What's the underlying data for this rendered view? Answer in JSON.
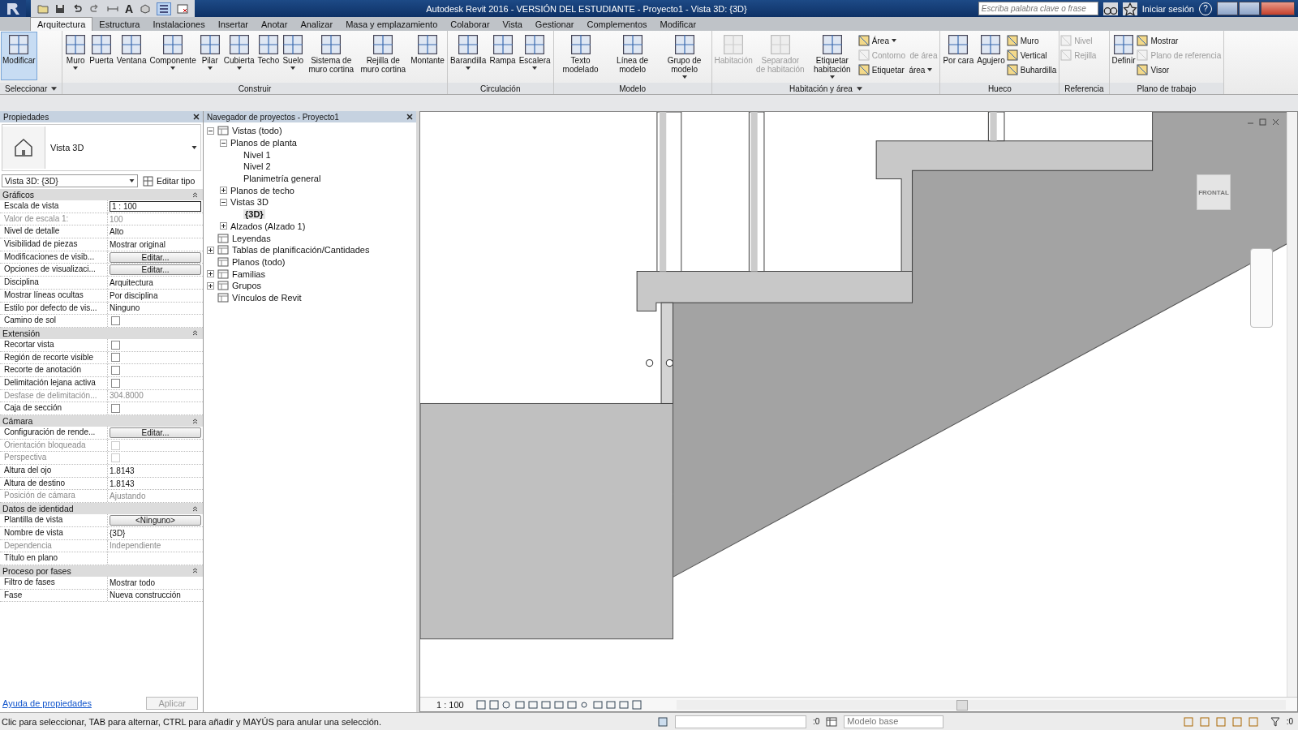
{
  "title_bar": {
    "title": "Autodesk Revit 2016 - VERSIÓN DEL ESTUDIANTE - Proyecto1 - Vista 3D: {3D}",
    "text_tool": "A",
    "search": {
      "placeholder": "Escriba palabra clave o frase"
    },
    "sign_in": "Iniciar sesión",
    "help": "?"
  },
  "tabs": [
    {
      "label": "Arquitectura",
      "selected": true
    },
    {
      "label": "Estructura",
      "selected": false
    },
    {
      "label": "Instalaciones",
      "selected": false
    },
    {
      "label": "Insertar",
      "selected": false
    },
    {
      "label": "Anotar",
      "selected": false
    },
    {
      "label": "Analizar",
      "selected": false
    },
    {
      "label": "Masa y emplazamiento",
      "selected": false
    },
    {
      "label": "Colaborar",
      "selected": false
    },
    {
      "label": "Vista",
      "selected": false
    },
    {
      "label": "Gestionar",
      "selected": false
    },
    {
      "label": "Complementos",
      "selected": false
    },
    {
      "label": "Modificar",
      "selected": false
    }
  ],
  "ribbon": [
    {
      "title": "Seleccionar",
      "menu": true,
      "tools": [
        {
          "label": "Modificar",
          "kind": "large",
          "selected": true,
          "disabled": false,
          "dropdown": false
        }
      ]
    },
    {
      "title": "Construir",
      "menu": false,
      "tools": [
        {
          "label": "Muro",
          "kind": "large",
          "selected": false,
          "disabled": false,
          "dropdown": true
        },
        {
          "label": "Puerta",
          "kind": "large",
          "selected": false,
          "disabled": false,
          "dropdown": false
        },
        {
          "label": "Ventana",
          "kind": "large",
          "selected": false,
          "disabled": false,
          "dropdown": false
        },
        {
          "label": "Componente",
          "kind": "large",
          "selected": false,
          "disabled": false,
          "dropdown": true
        },
        {
          "label": "Pilar",
          "kind": "large",
          "selected": false,
          "disabled": false,
          "dropdown": true
        },
        {
          "label": "Cubierta",
          "kind": "large",
          "selected": false,
          "disabled": false,
          "dropdown": true
        },
        {
          "label": "Techo",
          "kind": "large",
          "selected": false,
          "disabled": false,
          "dropdown": false
        },
        {
          "label": "Suelo",
          "kind": "large",
          "selected": false,
          "disabled": false,
          "dropdown": true
        },
        {
          "label": "Sistema de muro cortina",
          "kind": "large",
          "selected": false,
          "disabled": false,
          "dropdown": false
        },
        {
          "label": "Rejilla de muro cortina",
          "kind": "large",
          "selected": false,
          "disabled": false,
          "dropdown": false
        },
        {
          "label": "Montante",
          "kind": "large",
          "selected": false,
          "disabled": false,
          "dropdown": false
        }
      ]
    },
    {
      "title": "Circulación",
      "menu": false,
      "tools": [
        {
          "label": "Barandilla",
          "kind": "large",
          "selected": false,
          "disabled": false,
          "dropdown": true
        },
        {
          "label": "Rampa",
          "kind": "large",
          "selected": false,
          "disabled": false,
          "dropdown": false
        },
        {
          "label": "Escalera",
          "kind": "large",
          "selected": false,
          "disabled": false,
          "dropdown": true
        }
      ]
    },
    {
      "title": "Modelo",
      "menu": false,
      "tools": [
        {
          "label": "Texto modelado",
          "kind": "large",
          "selected": false,
          "disabled": false,
          "dropdown": false
        },
        {
          "label": "Línea de modelo",
          "kind": "large",
          "selected": false,
          "disabled": false,
          "dropdown": false
        },
        {
          "label": "Grupo de modelo",
          "kind": "large",
          "selected": false,
          "disabled": false,
          "dropdown": true
        }
      ]
    },
    {
      "title": "Habitación y área",
      "menu": true,
      "tools": [
        {
          "label": "Habitación",
          "kind": "large",
          "selected": false,
          "disabled": true,
          "dropdown": false
        },
        {
          "label": "Separador de habitación",
          "kind": "large",
          "selected": false,
          "disabled": true,
          "dropdown": false
        },
        {
          "label": "Etiquetar habitación",
          "kind": "large",
          "selected": false,
          "disabled": false,
          "dropdown": true
        },
        {
          "label": "Área",
          "kind": "small",
          "selected": false,
          "disabled": false,
          "dropdown": true
        },
        {
          "label": "Contorno  de área",
          "kind": "small",
          "selected": false,
          "disabled": true,
          "dropdown": false
        },
        {
          "label": "Etiquetar  área",
          "kind": "small",
          "selected": false,
          "disabled": false,
          "dropdown": true
        }
      ]
    },
    {
      "title": "Hueco",
      "menu": false,
      "tools": [
        {
          "label": "Por cara",
          "kind": "large",
          "selected": false,
          "disabled": false,
          "dropdown": false
        },
        {
          "label": "Agujero",
          "kind": "large",
          "selected": false,
          "disabled": false,
          "dropdown": false
        },
        {
          "label": "Muro",
          "kind": "small",
          "selected": false,
          "disabled": false,
          "dropdown": false
        },
        {
          "label": "Vertical",
          "kind": "small",
          "selected": false,
          "disabled": false,
          "dropdown": false
        },
        {
          "label": "Buhardilla",
          "kind": "small",
          "selected": false,
          "disabled": false,
          "dropdown": false
        }
      ]
    },
    {
      "title": "Referencia",
      "menu": false,
      "tools": [
        {
          "label": "Nivel",
          "kind": "small",
          "selected": false,
          "disabled": true,
          "dropdown": false
        },
        {
          "label": "Rejilla",
          "kind": "small",
          "selected": false,
          "disabled": true,
          "dropdown": false
        }
      ]
    },
    {
      "title": "Plano de trabajo",
      "menu": false,
      "tools": [
        {
          "label": "Definir",
          "kind": "large",
          "selected": false,
          "disabled": false,
          "dropdown": false
        },
        {
          "label": "Mostrar",
          "kind": "small",
          "selected": false,
          "disabled": false,
          "dropdown": false
        },
        {
          "label": "Plano de referencia",
          "kind": "small",
          "selected": false,
          "disabled": true,
          "dropdown": false
        },
        {
          "label": "Visor",
          "kind": "small",
          "selected": false,
          "disabled": false,
          "dropdown": false
        }
      ]
    }
  ],
  "properties": {
    "title": "Propiedades",
    "type_name": "Vista 3D",
    "type_selector": "Vista 3D: {3D}",
    "edit_type": "Editar tipo",
    "groups": [
      {
        "name": "Gráficos",
        "rows": [
          {
            "label": "Escala de vista",
            "kind": "input",
            "value": "1 : 100",
            "disabled": false
          },
          {
            "label": "Valor de escala    1:",
            "kind": "text",
            "value": "100",
            "disabled": true
          },
          {
            "label": "Nivel de detalle",
            "kind": "text",
            "value": "Alto",
            "disabled": false
          },
          {
            "label": "Visibilidad de piezas",
            "kind": "text",
            "value": "Mostrar original",
            "disabled": false
          },
          {
            "label": "Modificaciones de visib...",
            "kind": "button",
            "value": "Editar...",
            "disabled": false
          },
          {
            "label": "Opciones de visualizaci...",
            "kind": "button",
            "value": "Editar...",
            "disabled": false
          },
          {
            "label": "Disciplina",
            "kind": "text",
            "value": "Arquitectura",
            "disabled": false
          },
          {
            "label": "Mostrar líneas ocultas",
            "kind": "text",
            "value": "Por disciplina",
            "disabled": false
          },
          {
            "label": "Estilo por defecto de vis...",
            "kind": "text",
            "value": "Ninguno",
            "disabled": false
          },
          {
            "label": "Camino de sol",
            "kind": "checkbox",
            "checked": false,
            "disabled": false
          }
        ]
      },
      {
        "name": "Extensión",
        "rows": [
          {
            "label": "Recortar vista",
            "kind": "checkbox",
            "checked": false,
            "disabled": false
          },
          {
            "label": "Región de recorte visible",
            "kind": "checkbox",
            "checked": false,
            "disabled": false
          },
          {
            "label": "Recorte de anotación",
            "kind": "checkbox",
            "checked": false,
            "disabled": false
          },
          {
            "label": "Delimitación lejana activa",
            "kind": "checkbox",
            "checked": false,
            "disabled": false
          },
          {
            "label": "Desfase de delimitación...",
            "kind": "text",
            "value": "304.8000",
            "disabled": true
          },
          {
            "label": "Caja de sección",
            "kind": "checkbox",
            "checked": false,
            "disabled": false
          }
        ]
      },
      {
        "name": "Cámara",
        "rows": [
          {
            "label": "Configuración de rende...",
            "kind": "button",
            "value": "Editar...",
            "disabled": false
          },
          {
            "label": "Orientación bloqueada",
            "kind": "checkbox",
            "checked": false,
            "disabled": true
          },
          {
            "label": "Perspectiva",
            "kind": "checkbox",
            "checked": false,
            "disabled": true
          },
          {
            "label": "Altura del ojo",
            "kind": "text",
            "value": "1.8143",
            "disabled": false
          },
          {
            "label": "Altura de destino",
            "kind": "text",
            "value": "1.8143",
            "disabled": false
          },
          {
            "label": "Posición de cámara",
            "kind": "text",
            "value": "Ajustando",
            "disabled": true
          }
        ]
      },
      {
        "name": "Datos de identidad",
        "rows": [
          {
            "label": "Plantilla de vista",
            "kind": "button",
            "value": "<Ninguno>",
            "disabled": false
          },
          {
            "label": "Nombre de vista",
            "kind": "text",
            "value": "{3D}",
            "disabled": false
          },
          {
            "label": "Dependencia",
            "kind": "text",
            "value": "Independiente",
            "disabled": true
          },
          {
            "label": "Título en plano",
            "kind": "text",
            "value": "",
            "disabled": false
          }
        ]
      },
      {
        "name": "Proceso por fases",
        "rows": [
          {
            "label": "Filtro de fases",
            "kind": "text",
            "value": "Mostrar todo",
            "disabled": false
          },
          {
            "label": "Fase",
            "kind": "text",
            "value": "Nueva construcción",
            "disabled": false
          }
        ]
      }
    ],
    "help_link": "Ayuda de propiedades",
    "apply": "Aplicar"
  },
  "browser": {
    "title": "Navegador de proyectos - Proyecto1",
    "tree": [
      {
        "label": "Vistas (todo)",
        "expanded": true,
        "selected": false,
        "children": [
          {
            "label": "Planos de planta",
            "expanded": true,
            "selected": false,
            "children": [
              {
                "label": "Nivel 1",
                "selected": false
              },
              {
                "label": "Nivel 2",
                "selected": false
              },
              {
                "label": "Planimetría general",
                "selected": false
              }
            ]
          },
          {
            "label": "Planos de techo",
            "expanded": false,
            "selected": false
          },
          {
            "label": "Vistas 3D",
            "expanded": true,
            "selected": false,
            "children": [
              {
                "label": "{3D}",
                "selected": true
              }
            ]
          },
          {
            "label": "Alzados (Alzado 1)",
            "expanded": false,
            "selected": false
          }
        ]
      },
      {
        "label": "Leyendas",
        "selected": false
      },
      {
        "label": "Tablas de planificación/Cantidades",
        "expanded": false,
        "selected": false
      },
      {
        "label": "Planos (todo)",
        "selected": false
      },
      {
        "label": "Familias",
        "expanded": false,
        "selected": false
      },
      {
        "label": "Grupos",
        "expanded": false,
        "selected": false
      },
      {
        "label": "Vínculos de Revit",
        "selected": false
      }
    ]
  },
  "viewport": {
    "viewcube_label": "FRONTAL",
    "scale": "1 : 100"
  },
  "status_bar": {
    "message": "Clic para seleccionar, TAB para alternar, CTRL para añadir y MAYÚS para anular una selección.",
    "count": ":0",
    "workset": "Modelo base",
    "filter_count": ":0"
  }
}
